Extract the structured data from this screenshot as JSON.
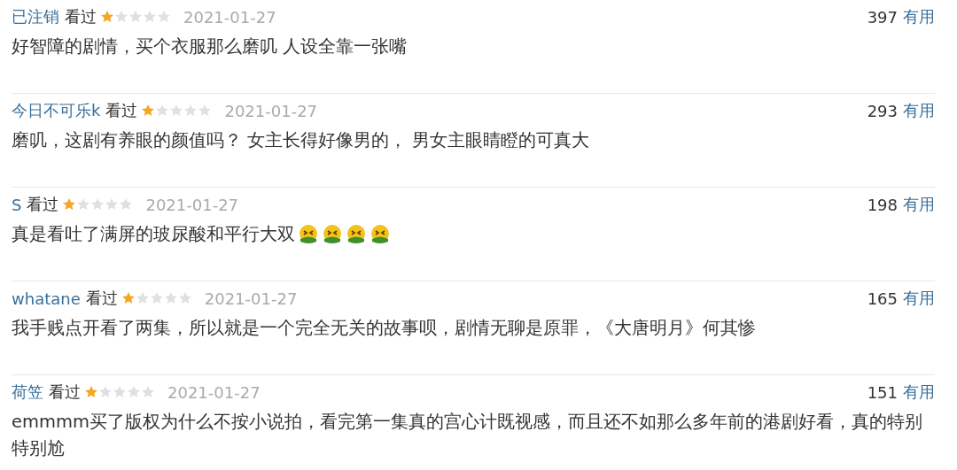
{
  "reviews": [
    {
      "user": "已注销",
      "status": "看过",
      "stars": 1,
      "date": "2021-01-27",
      "votes": "397",
      "vote_label": "有用",
      "text": "好智障的剧情，买个衣服那么磨叽 人设全靠一张嘴"
    },
    {
      "user": "今日不可乐k",
      "status": "看过",
      "stars": 1,
      "date": "2021-01-27",
      "votes": "293",
      "vote_label": "有用",
      "text": "磨叽，这剧有养眼的颜值吗？ 女主长得好像男的， 男女主眼睛瞪的可真大"
    },
    {
      "user": "S",
      "status": "看过",
      "stars": 1,
      "date": "2021-01-27",
      "votes": "198",
      "vote_label": "有用",
      "text": "真是看吐了满屏的玻尿酸和平行大双",
      "emojis": [
        {
          "kind": "sick"
        },
        {
          "kind": "sick"
        },
        {
          "kind": "sick"
        },
        {
          "kind": "sick"
        }
      ]
    },
    {
      "user": "whatane",
      "status": "看过",
      "stars": 1,
      "date": "2021-01-27",
      "votes": "165",
      "vote_label": "有用",
      "text": "我手贱点开看了两集，所以就是一个完全无关的故事呗，剧情无聊是原罪，《大唐明月》何其惨"
    },
    {
      "user": "荷笠",
      "status": "看过",
      "stars": 1,
      "date": "2021-01-27",
      "votes": "151",
      "vote_label": "有用",
      "text": "emmmm买了版权为什么不按小说拍，看完第一集真的宫心计既视感，而且还不如那么多年前的港剧好看，真的特别特别尬"
    }
  ]
}
